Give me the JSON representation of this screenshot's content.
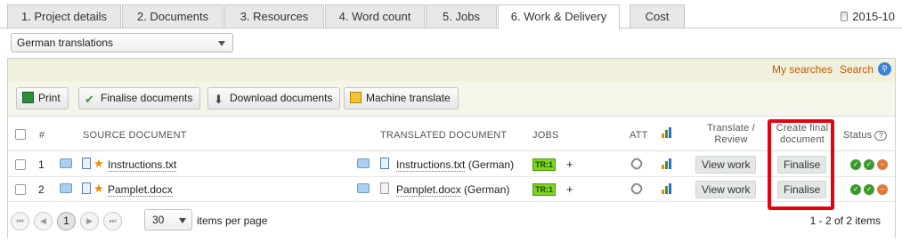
{
  "tabs": [
    {
      "label": "1. Project details"
    },
    {
      "label": "2. Documents"
    },
    {
      "label": "3. Resources"
    },
    {
      "label": "4. Word count"
    },
    {
      "label": "5. Jobs"
    },
    {
      "label": "6. Work & Delivery",
      "active": true
    },
    {
      "label": "Cost"
    }
  ],
  "version": "2015-10",
  "filter": {
    "selected": "German translations"
  },
  "search_bar": {
    "my_searches": "My searches",
    "search": "Search"
  },
  "toolbar": {
    "print": "Print",
    "finalise": "Finalise documents",
    "download": "Download documents",
    "machine": "Machine translate"
  },
  "columns": {
    "num": "#",
    "source": "Source document",
    "translated": "Translated document",
    "jobs": "Jobs",
    "att": "ATT",
    "translate_review_1": "Translate /",
    "translate_review_2": "Review",
    "create_final_1": "Create final",
    "create_final_2": "document",
    "status": "Status",
    "status_help": "?"
  },
  "rows": [
    {
      "num": "1",
      "source": "Instructions.txt",
      "translated": "Instructions.txt",
      "lang": "(German)",
      "job": "TR:1",
      "plus": "+",
      "view": "View work",
      "finalise": "Finalise"
    },
    {
      "num": "2",
      "source": "Pamplet.docx",
      "translated": "Pamplet.docx",
      "lang": "(German)",
      "job": "TR:1",
      "plus": "+",
      "view": "View work",
      "finalise": "Finalise"
    }
  ],
  "pager": {
    "current_page": "1",
    "per_page": "30",
    "per_page_label": "items per page",
    "summary": "1 - 2 of 2 items"
  },
  "colors": {
    "accent": "#c25a00",
    "highlight": "#e8000c",
    "job_badge": "#7ed321"
  }
}
